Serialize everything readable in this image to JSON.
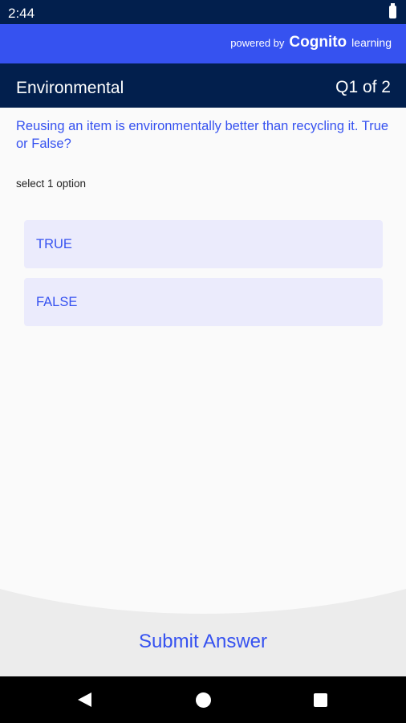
{
  "status_bar": {
    "time": "2:44"
  },
  "brand": {
    "powered_by": "powered by",
    "name": "Cognito",
    "suffix": "learning"
  },
  "quiz": {
    "title": "Environmental",
    "progress": "Q1 of 2"
  },
  "question": {
    "text": "Reusing an item is environmentally better than recycling it. True or False?",
    "instruction": "select 1 option",
    "options": [
      {
        "label": "TRUE"
      },
      {
        "label": "FALSE"
      }
    ]
  },
  "footer": {
    "submit_label": "Submit Answer"
  },
  "colors": {
    "navy": "#021f4d",
    "accent": "#3652f0",
    "option_bg": "#ebebfc",
    "footer_bg": "#ececec"
  }
}
